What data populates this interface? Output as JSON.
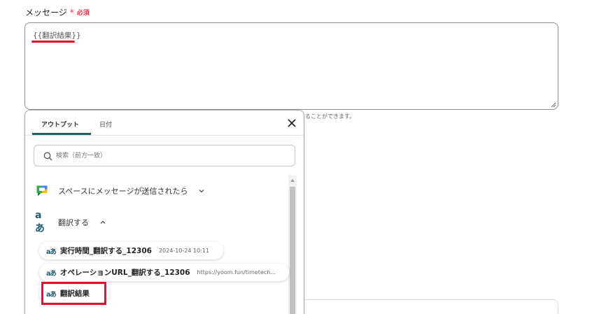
{
  "field": {
    "label": "メッセージ",
    "required_star": "*",
    "required_text": "必須",
    "value": "{{翻訳結果}}",
    "hint": "ることができます。"
  },
  "popup": {
    "tabs": [
      {
        "label": "アウトプット",
        "active": true
      },
      {
        "label": "日付",
        "active": false
      }
    ],
    "close_icon": "close-icon",
    "search": {
      "placeholder": "検索（前方一致）",
      "value": ""
    },
    "groups": [
      {
        "label": "スペースにメッセージが送信されたら",
        "icon": "google-chat-icon",
        "expanded": false
      },
      {
        "label": "翻訳する",
        "icon": "translate-icon",
        "expanded": true
      }
    ],
    "items": [
      {
        "icon": "aあ",
        "label": "実行時間_翻訳する_12306",
        "value": "2024-10-24 10:11"
      },
      {
        "icon": "aあ",
        "label": "オペレーションURL_翻訳する_12306",
        "value": "https://yoom.fun/timetech..."
      },
      {
        "icon": "aあ",
        "label": "翻訳結果",
        "value": ""
      }
    ]
  },
  "colors": {
    "accent": "#1d5d70",
    "highlight": "#e5102d",
    "required": "#e8334b"
  }
}
